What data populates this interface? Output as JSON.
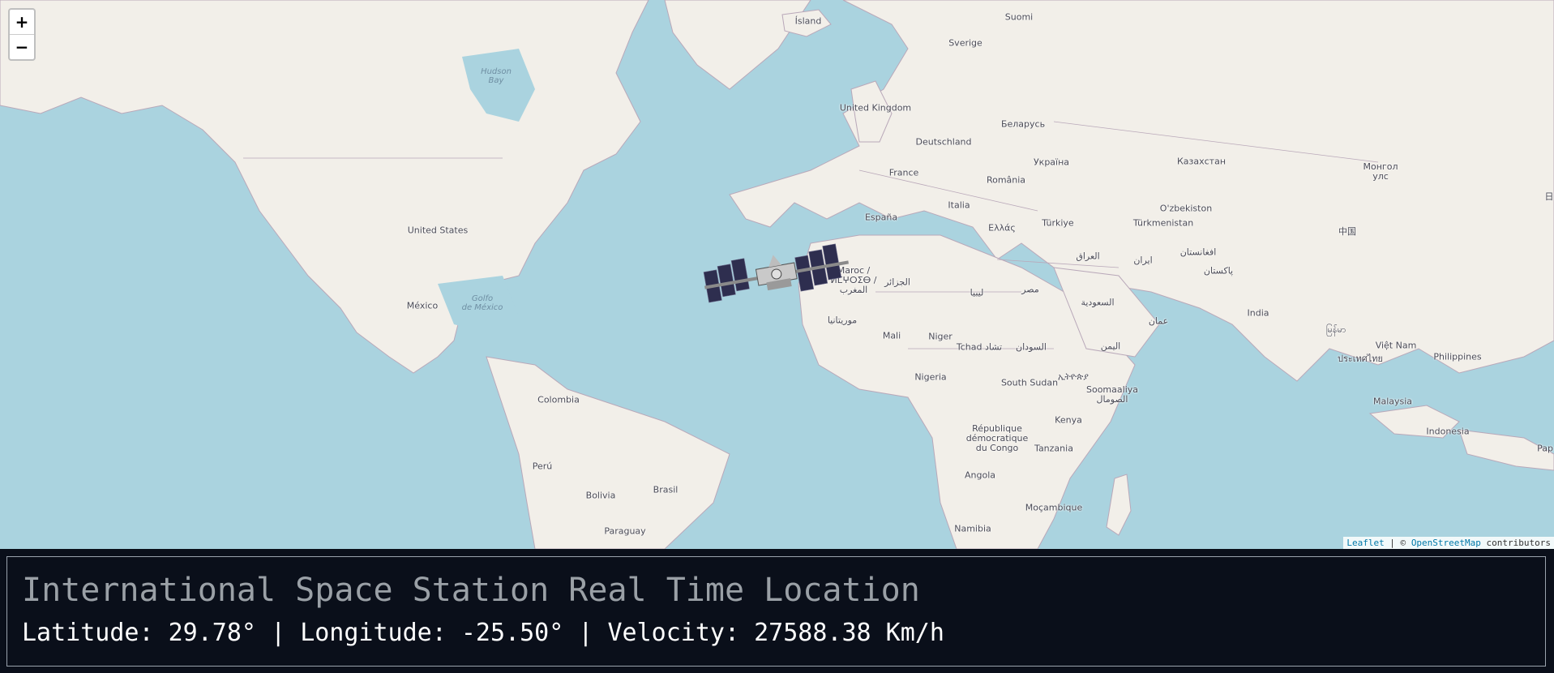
{
  "map": {
    "zoom_in_label": "+",
    "zoom_out_label": "−",
    "attribution": {
      "leaflet": "Leaflet",
      "separator": " | © ",
      "osm": "OpenStreetMap",
      "suffix": " contributors"
    },
    "labels": {
      "island": "Ísland",
      "suomi": "Suomi",
      "sverige": "Sverige",
      "hudson_bay": "Hudson\nBay",
      "united_kingdom": "United Kingdom",
      "belarus": "Беларусь",
      "deutschland": "Deutschland",
      "ukraina": "Україна",
      "france": "France",
      "romania": "România",
      "kazakhstan": "Казахстан",
      "mongolia": "Монгол\nулс",
      "italia": "Italia",
      "espana": "España",
      "uzbekistan": "O'zbekiston",
      "turkmenistan": "Türkmenistan",
      "ellas": "Ελλάς",
      "turkiye": "Türkiye",
      "china": "中国",
      "united_states": "United States",
      "iraq": "العراق",
      "iran": "ایران",
      "afghanistan": "افغانستان",
      "pakistan": "پاکستان",
      "maroc": "Maroc /\nⵍⵎⵖⵔⵉⴱ /\nالمغرب",
      "algeria": "الجزائر",
      "libya": "ليبيا",
      "egypt": "مصر",
      "saudi": "السعودية",
      "oman": "عمان",
      "india": "India",
      "mexico": "México",
      "gulf_mexico": "Golfo\nde México",
      "mauritania": "موريتانيا",
      "mali": "Mali",
      "niger": "Niger",
      "tchad": "Tchad تشاد",
      "sudan": "السودان",
      "yemen": "اليمن",
      "myanmar": "မြန်မာ",
      "vietnam": "Việt Nam",
      "thailand": "ประเทศไทย",
      "philippines": "Philippines",
      "nigeria": "Nigeria",
      "south_sudan": "South Sudan",
      "ethiopia": "ኢትዮጵያ",
      "somalia": "Soomaaliya\nالصومال",
      "colombia": "Colombia",
      "malaysia": "Malaysia",
      "kenya": "Kenya",
      "drc": "République\ndémocratique\ndu Congo",
      "indonesia": "Indonesia",
      "tanzania": "Tanzania",
      "peru": "Perú",
      "brasil": "Brasil",
      "angola": "Angola",
      "bolivia": "Bolivia",
      "mocambique": "Moçambique",
      "namibia": "Namibia",
      "paraguay": "Paraguay",
      "papua": "Pap",
      "japan_edge": "日"
    }
  },
  "iss": {
    "title": "International Space Station Real Time Location",
    "latitude_label": "Latitude:",
    "latitude": "29.78°",
    "longitude_label": "Longitude:",
    "longitude": "-25.50°",
    "velocity_label": "Velocity:",
    "velocity": "27588.38 Km/h",
    "separator": "|"
  },
  "colors": {
    "water": "#aad3df",
    "land": "#f2efe9",
    "panel_bg": "#0a0f1a",
    "title_text": "#9aa0a6",
    "telemetry_text": "#ffffff"
  }
}
